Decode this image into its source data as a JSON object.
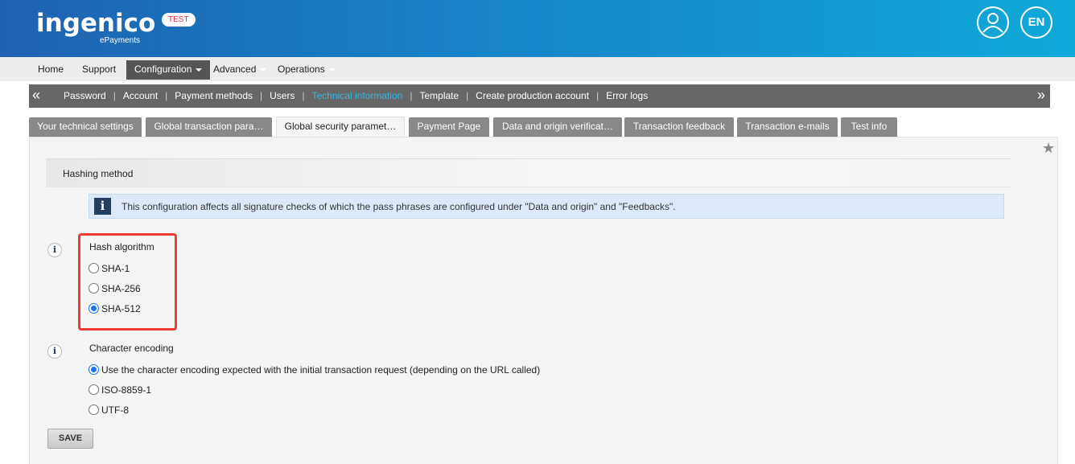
{
  "header": {
    "logo_main": "ingenico",
    "logo_sub": "ePayments",
    "env_badge": "TEST",
    "language": "EN",
    "user_icon": "user-circle-icon"
  },
  "topnav": {
    "items": [
      {
        "label": "Home"
      },
      {
        "label": "Support"
      },
      {
        "label": "Configuration"
      },
      {
        "label": "Advanced"
      },
      {
        "label": "Operations"
      }
    ]
  },
  "subnav": {
    "items": [
      {
        "label": "Password"
      },
      {
        "label": "Account"
      },
      {
        "label": "Payment methods"
      },
      {
        "label": "Users"
      },
      {
        "label": "Technical information"
      },
      {
        "label": "Template"
      },
      {
        "label": "Create production account"
      },
      {
        "label": "Error logs"
      }
    ],
    "left_arrow": "«",
    "right_arrow": "»",
    "separator": "|"
  },
  "tabs": [
    {
      "label": "Your technical settings"
    },
    {
      "label": "Global transaction para…"
    },
    {
      "label": "Global security paramet…"
    },
    {
      "label": "Payment Page"
    },
    {
      "label": "Data and origin verificat…"
    },
    {
      "label": "Transaction feedback"
    },
    {
      "label": "Transaction e-mails"
    },
    {
      "label": "Test info"
    }
  ],
  "panel": {
    "section_title": "Hashing method",
    "info_message": "This configuration affects all signature checks of which the pass phrases are configured under \"Data and origin\" and \"Feedbacks\".",
    "hash_algorithm": {
      "label": "Hash algorithm",
      "options": [
        "SHA-1",
        "SHA-256",
        "SHA-512"
      ],
      "selected": "SHA-512"
    },
    "character_encoding": {
      "label": "Character encoding",
      "options": [
        "Use the character encoding expected with the initial transaction request (depending on the URL called)",
        "ISO-8859-1",
        "UTF-8"
      ],
      "selected": "Use the character encoding expected with the initial transaction request (depending on the URL called)"
    },
    "save_label": "SAVE"
  },
  "colors": {
    "header_start": "#1f62b0",
    "header_end": "#10a9d8",
    "active_subnav": "#2fb7e3",
    "highlight": "#ee3b35",
    "radio_selected": "#1a73e8"
  }
}
